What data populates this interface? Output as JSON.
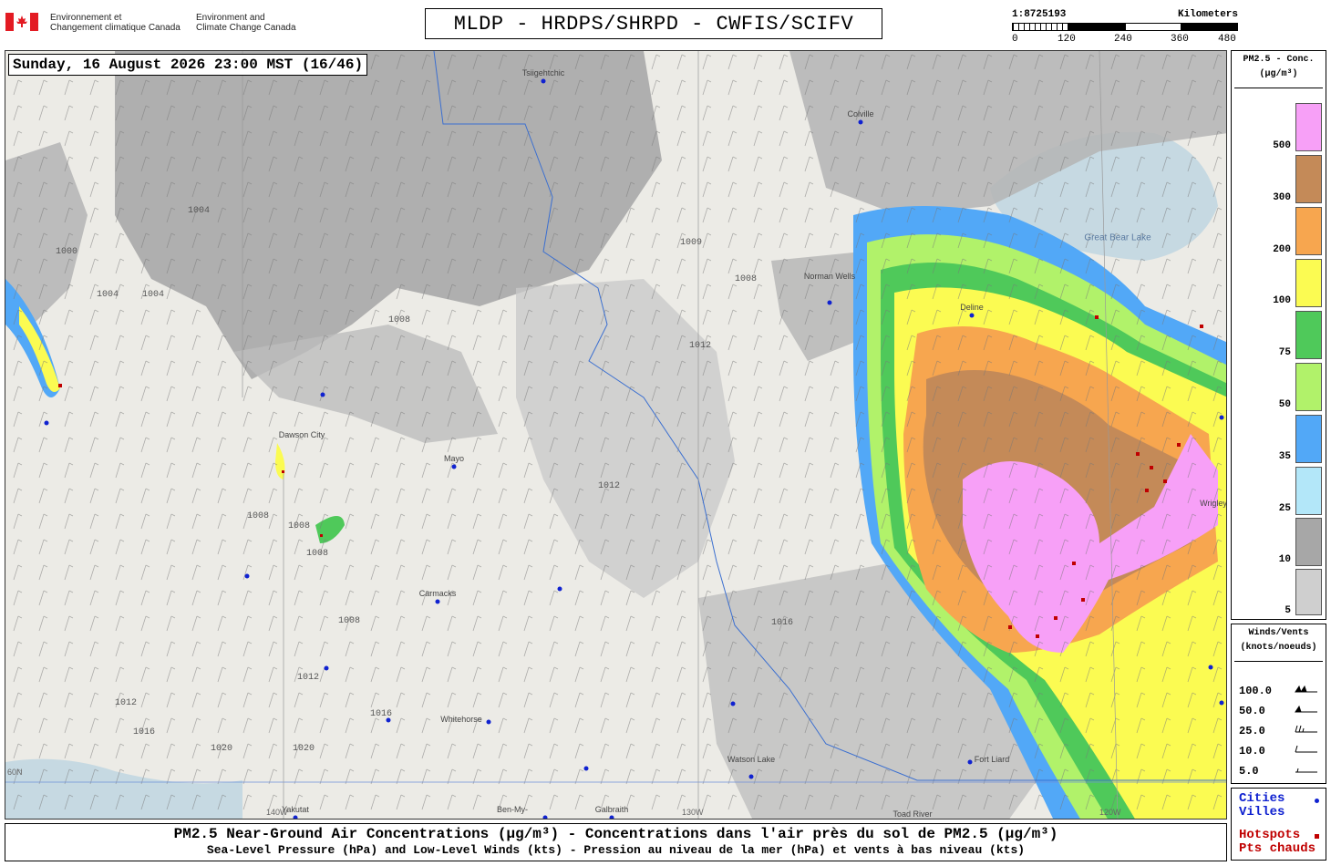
{
  "header": {
    "agency_fr": "Environnement et Changement climatique Canada",
    "agency_fr_line1": "Environnement et",
    "agency_fr_line2": "Changement climatique Canada",
    "agency_en_line1": "Environment and",
    "agency_en_line2": "Climate Change Canada",
    "title": "MLDP - HRDPS/SHRPD - CWFIS/SCIFV"
  },
  "scale": {
    "ratio": "1:8725193",
    "unit": "Kilometers",
    "ticks": [
      "0",
      "120",
      "240",
      "360",
      "480"
    ]
  },
  "map": {
    "timestamp": "Sunday, 16 August 2026 23:00 MST (16/46)",
    "cities": [
      {
        "name": "Tsiigehtchic"
      },
      {
        "name": "Colville"
      },
      {
        "name": "Norman Wells"
      },
      {
        "name": "Deline"
      },
      {
        "name": "Great Bear Lake"
      },
      {
        "name": "Dawson City"
      },
      {
        "name": "Mayo"
      },
      {
        "name": "Carmacks"
      },
      {
        "name": "Whitehorse"
      },
      {
        "name": "Watson Lake"
      },
      {
        "name": "Fort Liard"
      },
      {
        "name": "Yakutat"
      },
      {
        "name": "Ben-My-"
      },
      {
        "name": "Galbraith"
      },
      {
        "name": "Toad River"
      },
      {
        "name": "Wrigley"
      }
    ],
    "isobar_labels": [
      "1000",
      "1004",
      "1004",
      "1004",
      "1008",
      "1008",
      "1008",
      "1008",
      "1008",
      "1008",
      "1009",
      "1012",
      "1012",
      "1012",
      "1012",
      "1016",
      "1016",
      "1016",
      "1020",
      "1020"
    ],
    "lonlat_labels": [
      "60N",
      "140W",
      "130W",
      "120W"
    ]
  },
  "legend_pm": {
    "title_line1": "PM2.5 - Conc.",
    "title_line2": "(µg/m³)",
    "levels": [
      {
        "label": "500",
        "color": "#f7a0f7"
      },
      {
        "label": "300",
        "color": "#c48a58"
      },
      {
        "label": "200",
        "color": "#f7a64f"
      },
      {
        "label": "100",
        "color": "#fbfb52"
      },
      {
        "label": "75",
        "color": "#4fc95a"
      },
      {
        "label": "50",
        "color": "#b1f26a"
      },
      {
        "label": "35",
        "color": "#52a8f7"
      },
      {
        "label": "25",
        "color": "#b3e7f9"
      },
      {
        "label": "10",
        "color": "#a7a7a7"
      },
      {
        "label": "5",
        "color": "#cfcfcf"
      }
    ]
  },
  "legend_wind": {
    "title_line1": "Winds/Vents",
    "title_line2": "(knots/noeuds)",
    "speeds": [
      "100.0",
      "50.0",
      "25.0",
      "10.0",
      "5.0"
    ]
  },
  "legend_points": {
    "cities_en": "Cities",
    "cities_fr": "Villes",
    "hotspots_en": "Hotspots",
    "hotspots_fr": "Pts chauds",
    "city_color": "#1022d0",
    "hotspot_color": "#c00000"
  },
  "footer": {
    "line1": "PM2.5 Near-Ground Air Concentrations (µg/m³) - Concentrations dans l'air près du sol de PM2.5 (µg/m³)",
    "line2": "Sea-Level Pressure (hPa) and Low-Level Winds (kts) - Pression au niveau de la mer (hPa) et vents à bas niveau (kts)"
  }
}
